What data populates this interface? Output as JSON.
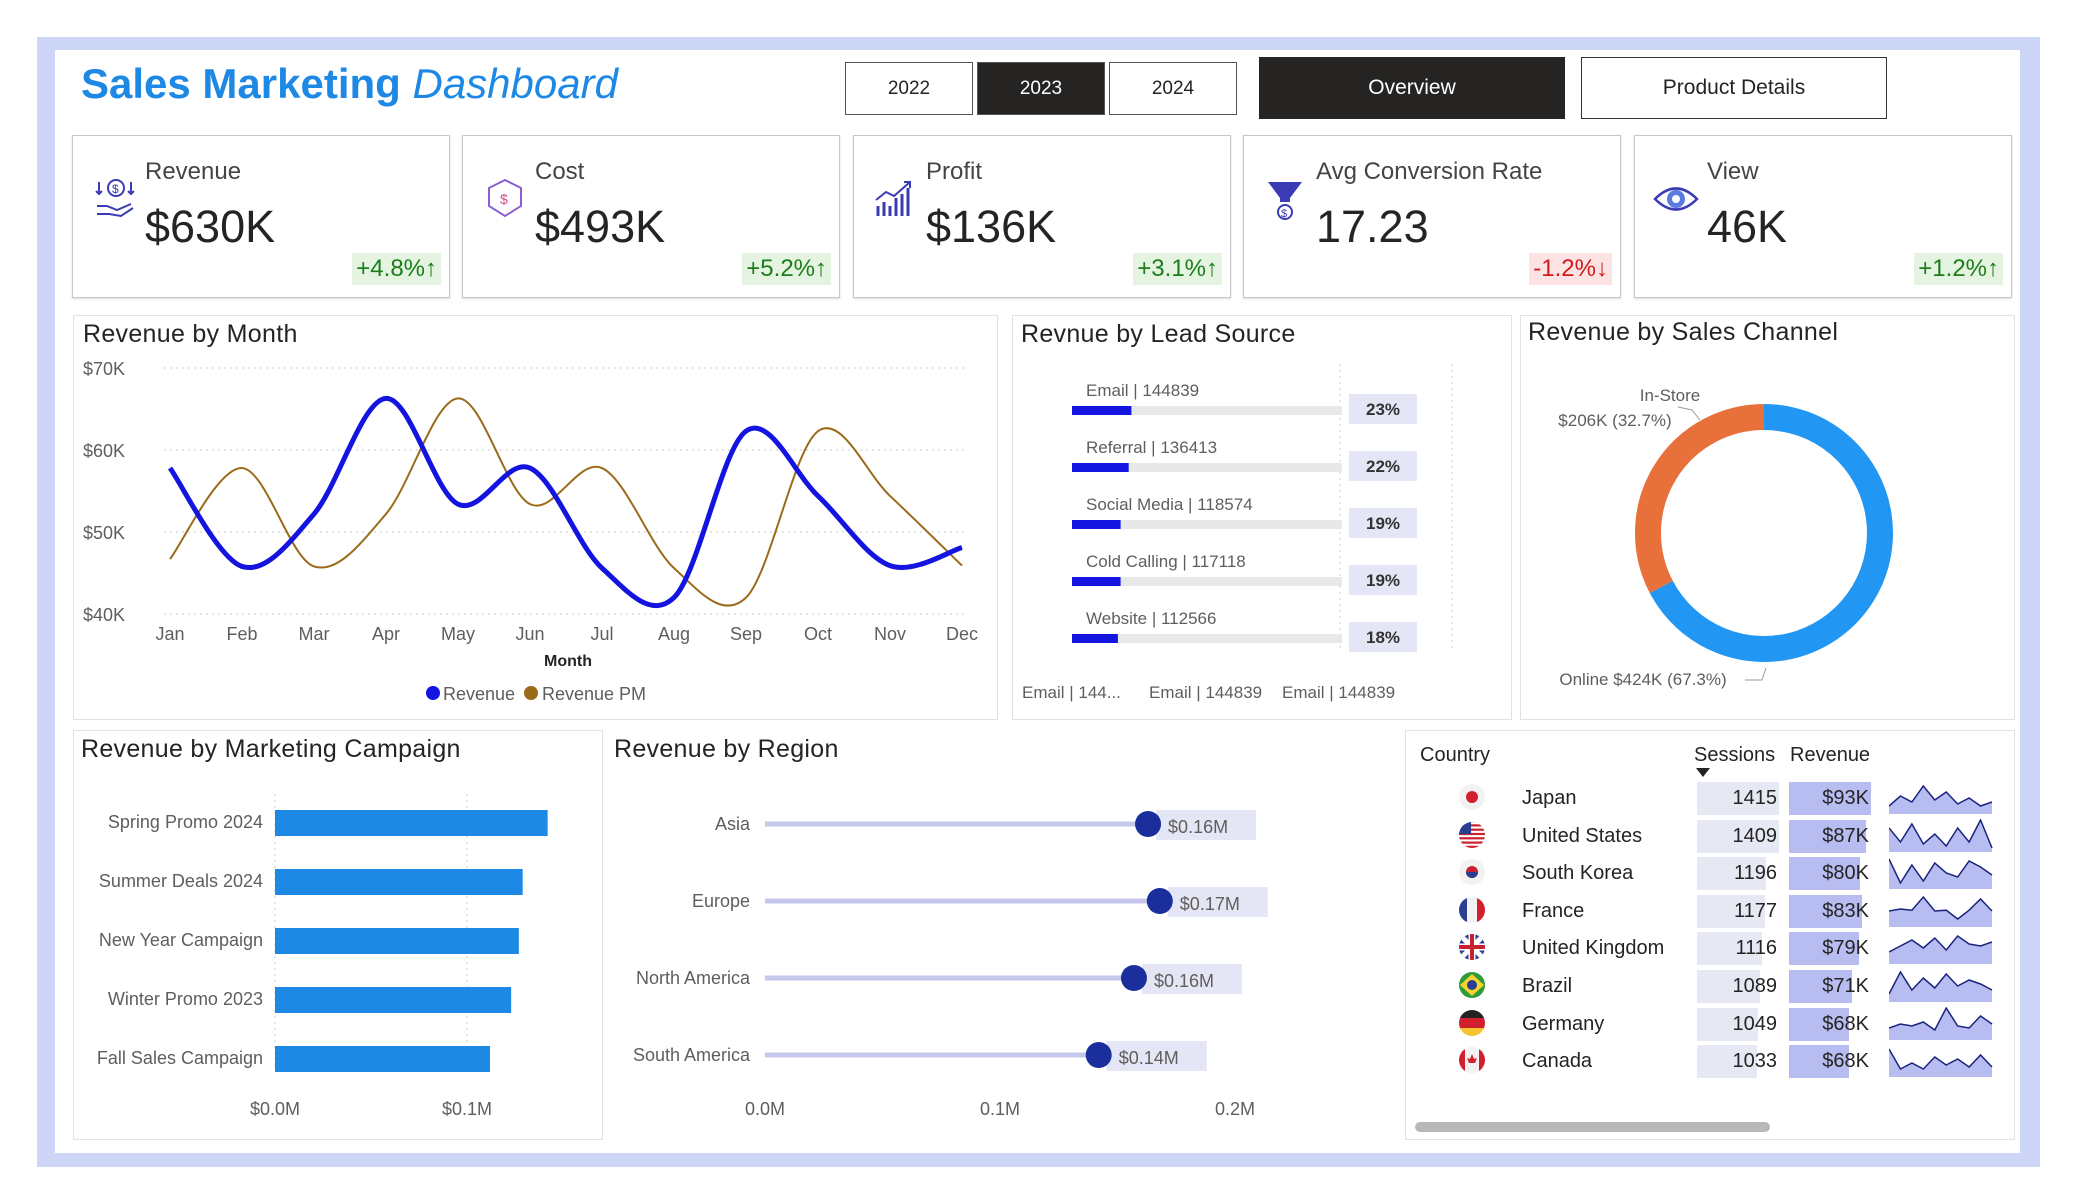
{
  "header": {
    "title_bold": "Sales Marketing",
    "title_italic": "Dashboard",
    "years": [
      "2022",
      "2023",
      "2024"
    ],
    "selected_year": "2023",
    "nav": {
      "overview": "Overview",
      "product_details": "Product Details"
    }
  },
  "kpis": [
    {
      "label": "Revenue",
      "value": "$630K",
      "change": "+4.8%↑",
      "trend": "up",
      "icon": "money-hand-icon"
    },
    {
      "label": "Cost",
      "value": "$493K",
      "change": "+5.2%↑",
      "trend": "up",
      "icon": "cost-tag-icon"
    },
    {
      "label": "Profit",
      "value": "$136K",
      "change": "+3.1%↑",
      "trend": "up",
      "icon": "growth-chart-icon"
    },
    {
      "label": "Avg Conversion Rate",
      "value": "17.23",
      "change": "-1.2%↓",
      "trend": "down",
      "icon": "funnel-icon"
    },
    {
      "label": "View",
      "value": "46K",
      "change": "+1.2%↑",
      "trend": "up",
      "icon": "eye-icon"
    }
  ],
  "colors": {
    "accent": "#1e88e5",
    "revenue_line": "#1414e0",
    "revenue_pm_line": "#9a6b1a",
    "lead_bar": "#1414e0",
    "instore": "#e8703a",
    "online": "#2196f3",
    "campaign_bar": "#1e88e5",
    "region_dot": "#1a2e9c",
    "kpi_up": "#1b7d1b",
    "kpi_down": "#d11b1b"
  },
  "chart_data": [
    {
      "type": "line",
      "title": "Revenue by Month",
      "xlabel": "Month",
      "categories": [
        "Jan",
        "Feb",
        "Mar",
        "Apr",
        "May",
        "Jun",
        "Jul",
        "Aug",
        "Sep",
        "Oct",
        "Nov",
        "Dec"
      ],
      "y_ticks": [
        "$40K",
        "$50K",
        "$60K",
        "$70K"
      ],
      "ylim": [
        40000,
        70000
      ],
      "series": [
        {
          "name": "Revenue",
          "values": [
            57800,
            45800,
            52200,
            66300,
            53400,
            57800,
            45600,
            42000,
            62300,
            54400,
            45900,
            48100
          ]
        },
        {
          "name": "Revenue PM",
          "values": [
            46700,
            57800,
            45800,
            52200,
            66300,
            53400,
            57800,
            45600,
            42000,
            62300,
            54400,
            45900
          ]
        }
      ],
      "legend": "bottom",
      "grid": true
    },
    {
      "type": "bar",
      "title": "Revnue by Lead Source",
      "categories": [
        "Email | 144839",
        "Referral | 136413",
        "Social Media | 118574",
        "Cold Calling | 117118",
        "Website | 112566"
      ],
      "values": [
        144839,
        136413,
        118574,
        117118,
        112566
      ],
      "percent_labels": [
        "23%",
        "22%",
        "19%",
        "19%",
        "18%"
      ],
      "bar_fraction": [
        0.22,
        0.21,
        0.18,
        0.18,
        0.17
      ],
      "footer_labels": [
        "Email | 144...",
        "Email | 144839",
        "Email | 144839"
      ]
    },
    {
      "type": "pie",
      "title": "Revenue by Sales Channel",
      "categories": [
        "In-Store",
        "Online"
      ],
      "values": [
        206,
        424
      ],
      "percents": [
        32.7,
        67.3
      ],
      "labels": [
        "In-Store",
        "$206K (32.7%)",
        "Online $424K (67.3%)"
      ]
    },
    {
      "type": "bar",
      "title": "Revenue by Marketing Campaign",
      "categories": [
        "Spring Promo 2024",
        "Summer Deals 2024",
        "New Year Campaign",
        "Winter Promo 2023",
        "Fall Sales Campaign"
      ],
      "values": [
        0.142,
        0.129,
        0.127,
        0.123,
        0.112
      ],
      "x_ticks": [
        "$0.0M",
        "$0.1M"
      ],
      "xlim": [
        0,
        0.1
      ]
    },
    {
      "type": "scatter",
      "title": "Revenue by Region",
      "categories": [
        "Asia",
        "Europe",
        "North America",
        "South America"
      ],
      "values": [
        0.163,
        0.168,
        0.157,
        0.142
      ],
      "value_labels": [
        "$0.16M",
        "$0.17M",
        "$0.16M",
        "$0.14M"
      ],
      "x_ticks": [
        "0.0M",
        "0.1M",
        "0.2M"
      ],
      "xlim": [
        0,
        0.2
      ]
    },
    {
      "type": "table",
      "columns": [
        "Country",
        "Sessions",
        "Revenue"
      ],
      "rows": [
        {
          "country": "Japan",
          "sessions": "1415",
          "revenue": "$93K",
          "sessions_n": 1415,
          "revenue_n": 93,
          "flag": "japan-flag-icon",
          "spark": [
            20,
            45,
            30,
            70,
            35,
            55,
            25,
            40,
            20,
            30
          ]
        },
        {
          "country": "United States",
          "sessions": "1409",
          "revenue": "$87K",
          "sessions_n": 1409,
          "revenue_n": 87,
          "flag": "us-flag-icon",
          "spark": [
            60,
            25,
            70,
            20,
            45,
            15,
            60,
            25,
            80,
            10
          ]
        },
        {
          "country": "South Korea",
          "sessions": "1196",
          "revenue": "$80K",
          "sessions_n": 1196,
          "revenue_n": 80,
          "flag": "south-korea-flag-icon",
          "spark": [
            75,
            15,
            60,
            20,
            65,
            40,
            30,
            70,
            55,
            35
          ]
        },
        {
          "country": "France",
          "sessions": "1177",
          "revenue": "$83K",
          "sessions_n": 1177,
          "revenue_n": 83,
          "flag": "france-flag-icon",
          "spark": [
            40,
            45,
            42,
            75,
            40,
            42,
            20,
            42,
            70,
            40
          ]
        },
        {
          "country": "United Kingdom",
          "sessions": "1116",
          "revenue": "$79K",
          "sessions_n": 1116,
          "revenue_n": 79,
          "flag": "uk-flag-icon",
          "spark": [
            30,
            45,
            60,
            40,
            65,
            35,
            70,
            50,
            45,
            55
          ]
        },
        {
          "country": "Brazil",
          "sessions": "1089",
          "revenue": "$71K",
          "sessions_n": 1089,
          "revenue_n": 71,
          "flag": "brazil-flag-icon",
          "spark": [
            20,
            75,
            30,
            60,
            35,
            70,
            40,
            55,
            45,
            30
          ]
        },
        {
          "country": "Germany",
          "sessions": "1049",
          "revenue": "$68K",
          "sessions_n": 1049,
          "revenue_n": 68,
          "flag": "germany-flag-icon",
          "spark": [
            30,
            40,
            35,
            45,
            25,
            80,
            35,
            30,
            60,
            40
          ]
        },
        {
          "country": "Canada",
          "sessions": "1033",
          "revenue": "$68K",
          "sessions_n": 1033,
          "revenue_n": 68,
          "flag": "canada-flag-icon",
          "spark": [
            70,
            20,
            35,
            20,
            50,
            30,
            45,
            25,
            55,
            25
          ]
        }
      ]
    }
  ]
}
